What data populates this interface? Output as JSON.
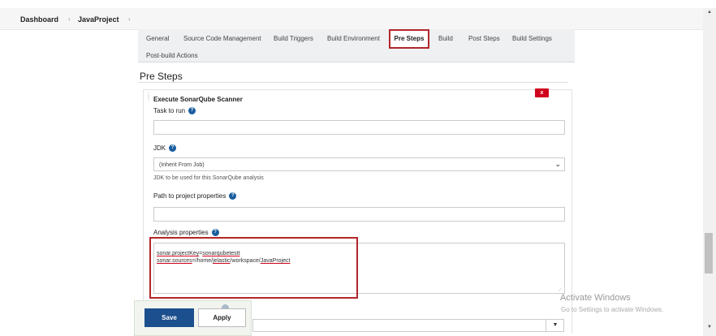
{
  "breadcrumb": {
    "items": [
      "Dashboard",
      "JavaProject"
    ],
    "separator": "›"
  },
  "tabs": {
    "items": [
      "General",
      "Source Code Management",
      "Build Triggers",
      "Build Environment",
      "Pre Steps",
      "Build",
      "Post Steps",
      "Build Settings",
      "Post-build Actions"
    ],
    "active": "Pre Steps"
  },
  "section": {
    "title": "Pre Steps"
  },
  "builder": {
    "title": "Execute SonarQube Scanner",
    "delete_label": "x",
    "task_label": "Task to run",
    "task_value": "",
    "jdk_label": "JDK",
    "jdk_value": "(Inherit From Job)",
    "jdk_desc": "JDK to be used for this SonarQube analysis",
    "path_label": "Path to project properties",
    "path_value": "",
    "analysis_label": "Analysis properties",
    "analysis_lines": [
      {
        "key": "sonar.projectKey",
        "eq": "=",
        "val": "sonarqubetestt"
      },
      {
        "key": "sonar.sources",
        "eq": "=/home/",
        "val": "jelastic",
        "rest": "/workspace/",
        "tail": "JavaProject"
      }
    ],
    "help_glyph": "?"
  },
  "footer": {
    "save_label": "Save",
    "apply_label": "Apply",
    "dropdown_arrow": "▼"
  },
  "watermark": {
    "line1": "Activate Windows",
    "line2": "Go to Settings to activate Windows."
  },
  "scrollbar": {
    "up": "▲",
    "down": "▼"
  },
  "colors": {
    "accent": "#1b4f8d",
    "highlight": "#b3262b",
    "delete": "#d0021b",
    "help": "#1a5d9e"
  }
}
